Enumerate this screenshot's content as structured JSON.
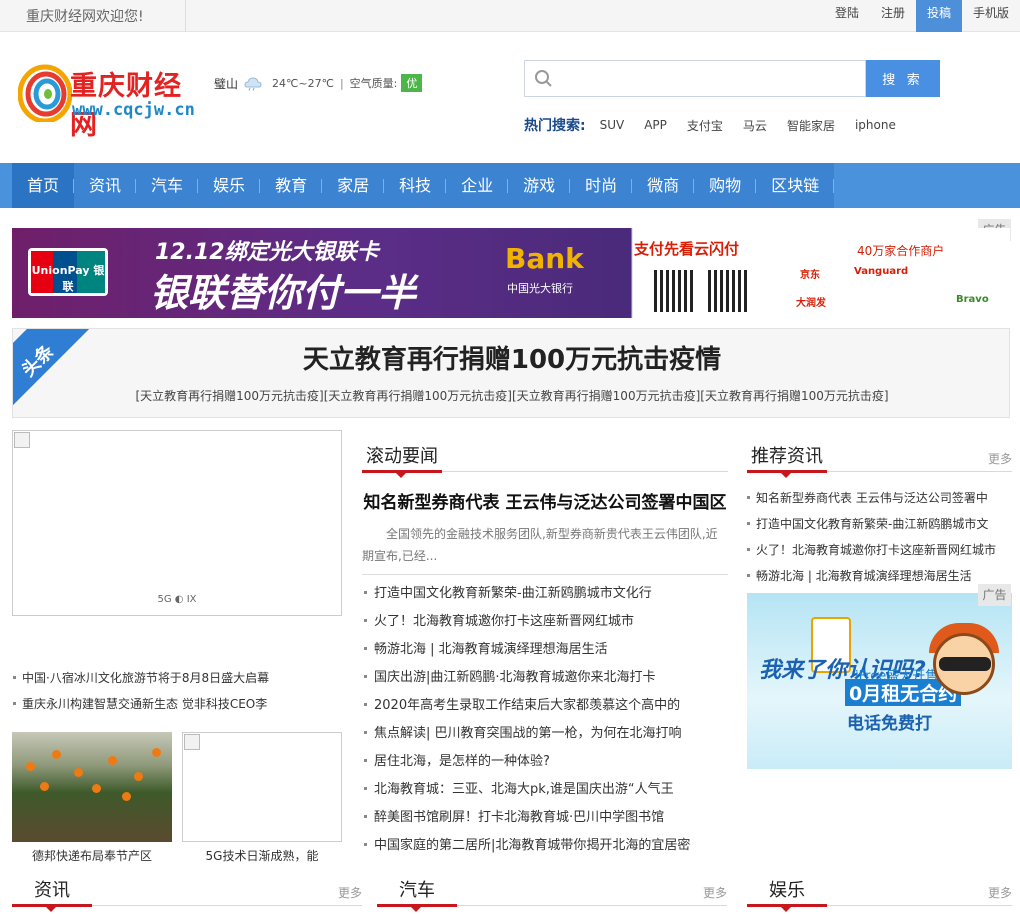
{
  "topbar": {
    "welcome": "重庆财经网欢迎您!",
    "links": [
      "登陆",
      "注册",
      "投稿",
      "手机版"
    ]
  },
  "logo": {
    "name": "重庆财经网",
    "url": "www.cqcjw.cn"
  },
  "weather": {
    "city": "璧山",
    "temp": "24℃~27℃",
    "sep": "|",
    "aq_label": "空气质量:",
    "aq_value": "优"
  },
  "search": {
    "placeholder": "",
    "button": "搜 索"
  },
  "hot": {
    "label": "热门搜索:",
    "keywords": [
      "SUV",
      "APP",
      "支付宝",
      "马云",
      "智能家居",
      "iphone"
    ]
  },
  "nav": [
    "首页",
    "资讯",
    "汽车",
    "娱乐",
    "教育",
    "家居",
    "科技",
    "企业",
    "游戏",
    "时尚",
    "微商",
    "购物",
    "区块链"
  ],
  "ads": {
    "tag": "广告"
  },
  "banner1": {
    "unionpay": "UnionPay 银联",
    "line1": "12.12绑定光大银联卡",
    "line2": "银联替你付一半",
    "bank": "Bank",
    "bank_sub": "中国光大银行",
    "pay": "支付先看云闪付",
    "merchants": "40万家合作商户",
    "brands": [
      "京东",
      "Vanguard",
      "大润发",
      "Bravo"
    ]
  },
  "headline": {
    "corner": "头条",
    "title": "天立教育再行捐赠100万元抗击疫情",
    "sub": "[天立教育再行捐赠100万元抗击疫][天立教育再行捐赠100万元抗击疫][天立教育再行捐赠100万元抗击疫][天立教育再行捐赠100万元抗击疫]"
  },
  "left": {
    "box_caption": "5G ◐ IX",
    "list": [
      "中国·八宿冰川文化旅游节将于8月8日盛大启幕",
      "重庆永川构建智慧交通新生态 觉非科技CEO李"
    ],
    "thumbs": [
      "德邦快递布局奉节产区",
      "5G技术日渐成熟，能"
    ]
  },
  "middle": {
    "header": "滚动要闻",
    "top_title": "知名新型券商代表 王云伟与泛达公司签署中国区",
    "top_desc": "全国领先的金融技术服务团队,新型券商新贵代表王云伟团队,近期宣布,已经...",
    "list": [
      "打造中国文化教育新繁荣-曲江新鸥鹏城市文化行",
      "火了！北海教育城邀你打卡这座新晋网红城市",
      "畅游北海 | 北海教育城演绎理想海居生活",
      "国庆出游|曲江新鸥鹏·北海教育城邀你来北海打卡",
      "2020年高考生录取工作结束后大家都羡慕这个高中的",
      "焦点解读| 巴川教育突围战的第一枪，为何在北海打响",
      "居住北海，是怎样的一种体验?",
      "北海教育城：三亚、北海大pk,谁是国庆出游“人气王",
      "醉美图书馆刷屏！打卡北海教育城·巴川中学图书馆",
      "中国家庭的第二居所|北海教育城带你揭开北海的宜居密"
    ]
  },
  "right": {
    "header": "推荐资讯",
    "more": "更多",
    "list": [
      "知名新型券商代表 王云伟与泛达公司签署中",
      "打造中国文化教育新繁荣-曲江新鸥鹏城市文",
      "火了！北海教育城邀你打卡这座新晋网红城市",
      "畅游北海 | 北海教育城演绎理想海居生活"
    ],
    "ad2": {
      "q": "我来了你认识吗?",
      "brand": "iFree盛大开售",
      "offer": "0月租无合约",
      "call": "电话免费打"
    }
  },
  "bottom_sections": [
    {
      "title": "资讯",
      "more": "更多"
    },
    {
      "title": "汽车",
      "more": "更多"
    },
    {
      "title": "娱乐",
      "more": "更多"
    }
  ]
}
